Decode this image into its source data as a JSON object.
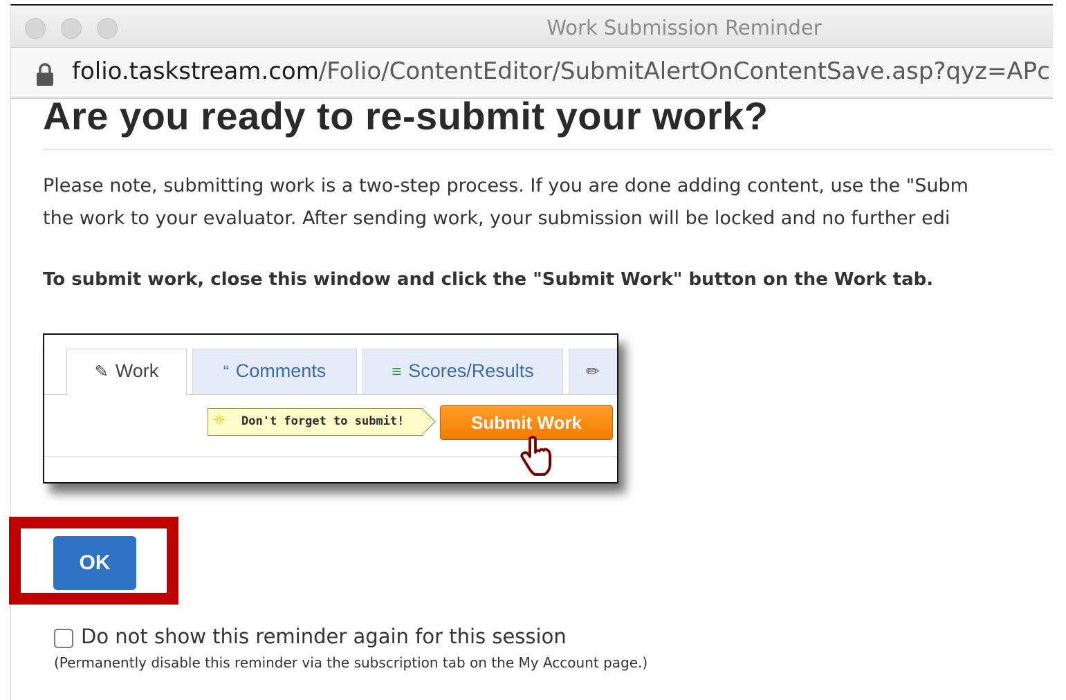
{
  "window": {
    "title": "Work Submission Reminder"
  },
  "address_bar": {
    "host": "folio.taskstream.com",
    "path": "/Folio/ContentEditor/SubmitAlertOnContentSave.asp?qyz=APc"
  },
  "dialog": {
    "heading": "Are you ready to re-submit your work?",
    "note_line1": "Please note, submitting work is a two-step process. If you are done adding content, use the \"Subm",
    "note_line2": "the work to your evaluator. After sending work, your submission will be locked and no further edi",
    "instruction": "To submit work, close this window and click the \"Submit Work\" button on the Work tab."
  },
  "illustration": {
    "tabs": [
      {
        "label": "Work",
        "icon": "edit-icon"
      },
      {
        "label": "Comments",
        "icon": "quote-icon"
      },
      {
        "label": "Scores/Results",
        "icon": "scores-icon"
      },
      {
        "label": "",
        "icon": "pencil-icon"
      }
    ],
    "tip": "Don't forget to submit!",
    "submit_button": "Submit Work"
  },
  "actions": {
    "ok_label": "OK",
    "checkbox_label": "Do not show this reminder again for this session",
    "disable_note": "(Permanently disable this reminder via the subscription tab on the My Account page.)"
  },
  "colors": {
    "ok_button": "#2d72c4",
    "highlight": "#c00000",
    "submit_button": "#f27a00"
  }
}
